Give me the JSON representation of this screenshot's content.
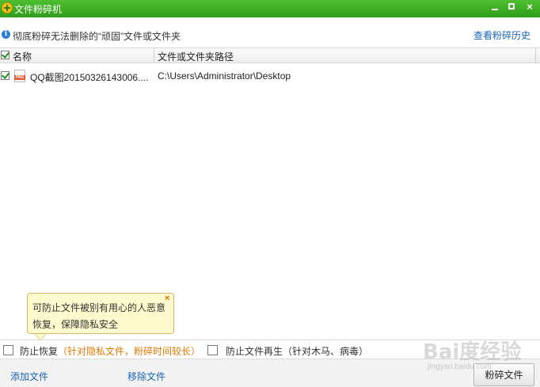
{
  "window": {
    "title": "文件粉碎机",
    "controls": {
      "minimize": "minimize-icon",
      "maximize": "maximize-icon",
      "close_label": "×"
    }
  },
  "info_bar": {
    "icon": "info-icon",
    "icon_glyph": "i",
    "text": "彻底粉碎无法删除的“顽固”文件或文件夹",
    "history_link": "查看粉碎历史"
  },
  "grid": {
    "columns": [
      "名称",
      "文件或文件夹路径"
    ],
    "header_checked": true,
    "rows": [
      {
        "checked": true,
        "icon": "png-file-icon",
        "name": "QQ截图20150326143006....",
        "path": "C:\\Users\\Administrator\\Desktop"
      }
    ]
  },
  "tooltip": {
    "line1": "可防止文件被别有用心的人恶意",
    "line2": "恢复，保障隐私安全",
    "close_glyph": "×",
    "background": "#fffbcf"
  },
  "options": {
    "prevent_recovery_label": "防止恢复",
    "prevent_recovery_note": "（针对隐私文件，粉碎时间较长）",
    "prevent_recovery_checked": false,
    "prevent_regen_label": "防止文件再生（针对木马、病毒）",
    "prevent_regen_checked": false
  },
  "footer": {
    "add_file": "添加文件",
    "remove_file": "移除文件",
    "shred_button": "粉碎文件"
  },
  "watermark": {
    "main": "Bai度经验",
    "sub": "jingyan.baidu.com"
  },
  "colors": {
    "titlebar": "#3aab24",
    "link": "#1a64b8",
    "note": "#e07a00"
  }
}
